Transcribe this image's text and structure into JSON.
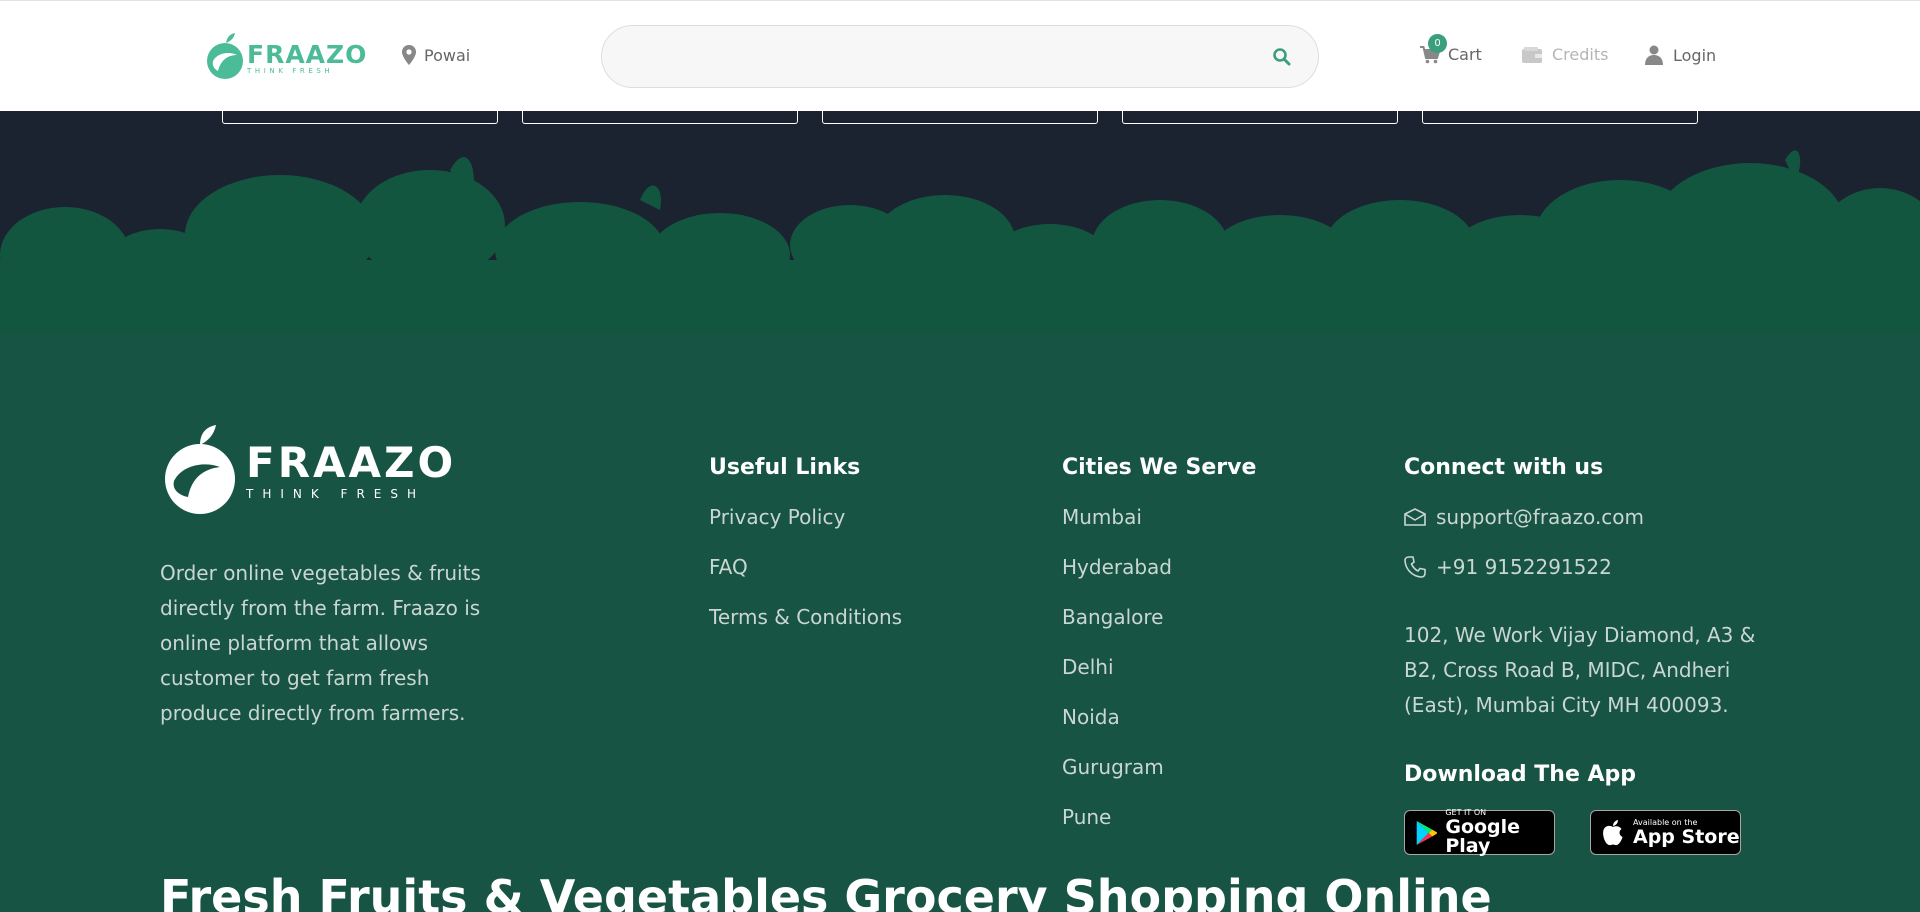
{
  "header": {
    "brand": {
      "name": "FRAAZO",
      "tagline": "THINK FRESH"
    },
    "location": "Powai",
    "search": {
      "placeholder": ""
    },
    "cart": {
      "count": "0",
      "label": "Cart"
    },
    "credits": {
      "label": "Credits"
    },
    "login": {
      "label": "Login"
    }
  },
  "footer": {
    "brand": {
      "name": "FRAAZO",
      "tagline": "THINK FRESH"
    },
    "about": "Order online vegetables & fruits directly from the farm. Fraazo is online platform that allows customer to get farm fresh produce directly from farmers.",
    "useful_links": {
      "heading": "Useful Links",
      "items": [
        "Privacy Policy",
        "FAQ",
        "Terms & Conditions"
      ]
    },
    "cities": {
      "heading": "Cities We Serve",
      "items": [
        "Mumbai",
        "Hyderabad",
        "Bangalore",
        "Delhi",
        "Noida",
        "Gurugram",
        "Pune"
      ]
    },
    "connect": {
      "heading": "Connect with us",
      "email": "support@fraazo.com",
      "phone": "+91 9152291522",
      "address": "102, We Work Vijay Diamond, A3 & B2, Cross Road B, MIDC, Andheri (East), Mumbai City MH 400093."
    },
    "download": {
      "heading": "Download The App",
      "google_play": {
        "small": "GET IT ON",
        "big": "Google Play"
      },
      "app_store": {
        "small": "Available on the",
        "big": "App Store"
      }
    },
    "seo_title": "Fresh Fruits & Vegetables Grocery Shopping Online"
  },
  "colors": {
    "brand_green": "#4cbb98",
    "footer_bg": "#185443",
    "dark_bg": "#1b2230",
    "silhouette": "#135640",
    "badge": "#3a9f7d"
  }
}
